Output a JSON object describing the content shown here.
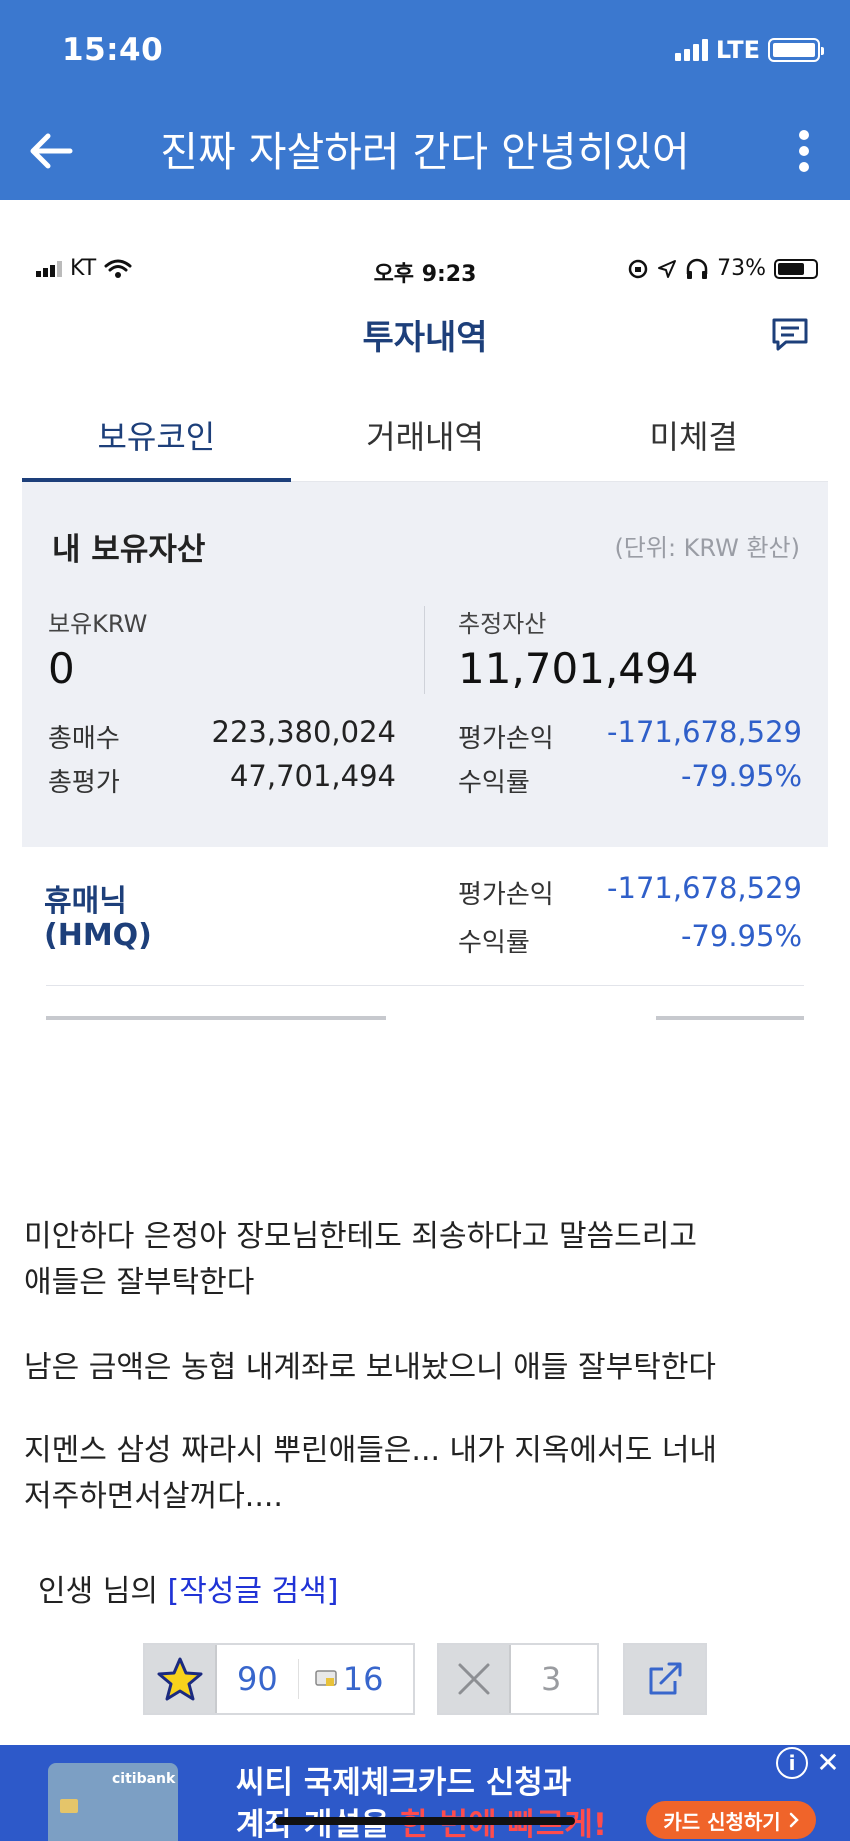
{
  "statusbar": {
    "time": "15:40",
    "network": "LTE"
  },
  "topbar": {
    "title": "진짜 자살하러 간다 안녕히있어"
  },
  "screenshot": {
    "statusbar": {
      "carrier": "KT",
      "time": "오후 9:23",
      "battery": "73%"
    },
    "header": {
      "title": "투자내역"
    },
    "tabs": [
      {
        "label": "보유코인",
        "active": true
      },
      {
        "label": "거래내역",
        "active": false
      },
      {
        "label": "미체결",
        "active": false
      }
    ],
    "assets": {
      "title": "내 보유자산",
      "unit": "(단위: KRW 환산)",
      "krw_label": "보유KRW",
      "krw_value": "0",
      "estimated_label": "추정자산",
      "estimated_value": "11,701,494",
      "total_buy_label": "총매수",
      "total_buy_value": "223,380,024",
      "total_eval_label": "총평가",
      "total_eval_value": "47,701,494",
      "pl_label": "평가손익",
      "pl_value": "-171,678,529",
      "rate_label": "수익률",
      "rate_value": "-79.95%"
    },
    "coin": {
      "name": "휴매닉",
      "symbol": "(HMQ)",
      "pl_label": "평가손익",
      "pl_value": "-171,678,529",
      "rate_label": "수익률",
      "rate_value": "-79.95%"
    }
  },
  "post": {
    "paragraphs": [
      "미안하다 은정아 장모님한테도 죄송하다고 말씀드리고",
      "애들은 잘부탁한다",
      "남은 금액은 농협 내계좌로 보내놨으니 애들 잘부탁한다",
      "지멘스 삼성 짜라시 뿌린애들은... 내가 지옥에서도 너내",
      "저주하면서살꺼다...."
    ],
    "author": "인생 님의",
    "author_link": "[작성글 검색]"
  },
  "votes": {
    "up": "90",
    "comments": "16",
    "down": "3"
  },
  "ad": {
    "card_brand": "citibank",
    "line1": "씨티 국제체크카드 신청과",
    "line2_a": "계좌 개설을 ",
    "line2_b": "한 번에 빠르게!",
    "cta": "카드 신청하기",
    "info": "i",
    "close": "✕"
  }
}
